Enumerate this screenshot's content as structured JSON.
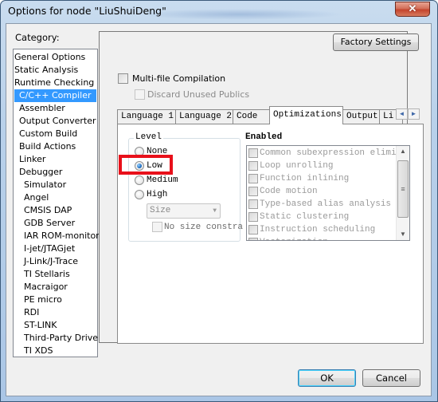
{
  "window": {
    "title": "Options for node \"LiuShuiDeng\"",
    "close_glyph": "✕"
  },
  "category": {
    "label": "Category:",
    "selected": "C/C++ Compiler",
    "items": [
      {
        "label": "General Options",
        "indent": 0
      },
      {
        "label": "Static Analysis",
        "indent": 0
      },
      {
        "label": "Runtime Checking",
        "indent": 0
      },
      {
        "label": "C/C++ Compiler",
        "indent": 1
      },
      {
        "label": "Assembler",
        "indent": 1
      },
      {
        "label": "Output Converter",
        "indent": 1
      },
      {
        "label": "Custom Build",
        "indent": 1
      },
      {
        "label": "Build Actions",
        "indent": 1
      },
      {
        "label": "Linker",
        "indent": 1
      },
      {
        "label": "Debugger",
        "indent": 1
      },
      {
        "label": "Simulator",
        "indent": 2
      },
      {
        "label": "Angel",
        "indent": 2
      },
      {
        "label": "CMSIS DAP",
        "indent": 2
      },
      {
        "label": "GDB Server",
        "indent": 2
      },
      {
        "label": "IAR ROM-monitor",
        "indent": 2
      },
      {
        "label": "I-jet/JTAGjet",
        "indent": 2
      },
      {
        "label": "J-Link/J-Trace",
        "indent": 2
      },
      {
        "label": "TI Stellaris",
        "indent": 2
      },
      {
        "label": "Macraigor",
        "indent": 2
      },
      {
        "label": "PE micro",
        "indent": 2
      },
      {
        "label": "RDI",
        "indent": 2
      },
      {
        "label": "ST-LINK",
        "indent": 2
      },
      {
        "label": "Third-Party Driver",
        "indent": 2
      },
      {
        "label": "TI XDS",
        "indent": 2
      }
    ]
  },
  "options": {
    "factory_settings": "Factory Settings",
    "multi_file": {
      "label": "Multi-file Compilation",
      "checked": false
    },
    "discard_unused": {
      "label": "Discard Unused Publics",
      "checked": false,
      "disabled": true
    },
    "tabs": [
      "Language 1",
      "Language 2",
      "Code",
      "Optimizations",
      "Output",
      "Li"
    ],
    "active_tab": "Optimizations",
    "tab_scroll": {
      "left": "◄",
      "right": "►"
    }
  },
  "optimizations": {
    "level": {
      "title": "Level",
      "options": [
        "None",
        "Low",
        "Medium",
        "High"
      ],
      "selected": "Low",
      "strategy_select": {
        "value": "Size",
        "arrow": "▼",
        "disabled": true
      },
      "no_size_constraints": {
        "label": "No size constra",
        "checked": false,
        "disabled": true
      }
    },
    "enabled": {
      "title": "Enabled",
      "items": [
        {
          "label": "Common subexpression elimina",
          "checked": false
        },
        {
          "label": "Loop unrolling",
          "checked": false
        },
        {
          "label": "Function inlining",
          "checked": false
        },
        {
          "label": "Code motion",
          "checked": false
        },
        {
          "label": "Type-based alias analysis",
          "checked": false
        },
        {
          "label": "Static clustering",
          "checked": false
        },
        {
          "label": "Instruction scheduling",
          "checked": false
        },
        {
          "label": "Vectorization",
          "checked": false
        }
      ],
      "scroll": {
        "up": "▲",
        "down": "▼",
        "grip": "≡"
      }
    }
  },
  "buttons": {
    "ok": "OK",
    "cancel": "Cancel"
  },
  "highlight": {
    "target": "Low",
    "color": "#e8101a"
  }
}
